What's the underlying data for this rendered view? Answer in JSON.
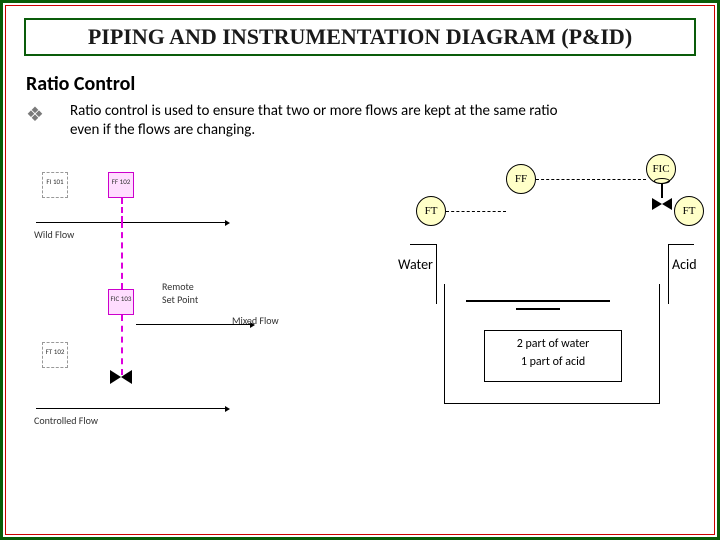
{
  "title": "PIPING AND INSTRUMENTATION DIAGRAM (P&ID)",
  "subtitle": "Ratio Control",
  "bullet_glyph": "❖",
  "description": "Ratio control is used to ensure that two or more flows are kept at the same ratio even if the flows are changing.",
  "left_diagram": {
    "tags": {
      "t1": "FI\n101",
      "t2": "FF\n102",
      "t3": "FIC\n103",
      "t4": "FT\n102"
    },
    "labels": {
      "wild": "Wild Flow",
      "mixed": "Mixed Flow",
      "controlled": "Controlled Flow",
      "remote_sp": "Remote\nSet Point"
    }
  },
  "right_diagram": {
    "instruments": {
      "fic": "FIC",
      "ff": "FF",
      "ft_left": "FT",
      "ft_right": "FT"
    },
    "streams": {
      "left": "Water",
      "right": "Acid"
    },
    "tank_text": {
      "line1": "2 part of water",
      "line2": "1 part of acid"
    }
  }
}
